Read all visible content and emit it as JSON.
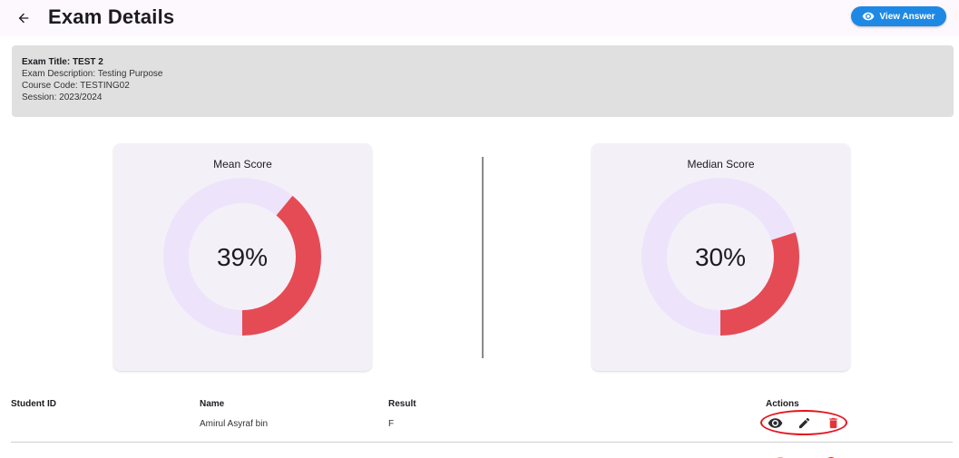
{
  "header": {
    "title": "Exam Details",
    "view_answer_label": "View Answer"
  },
  "exam_info": {
    "title_line": "Exam Title: TEST 2",
    "description_line": "Exam Description: Testing Purpose",
    "course_line": "Course Code:  TESTING02",
    "session_line": "Session: 2023/2024"
  },
  "scores": {
    "mean": {
      "label": "Mean Score",
      "value_text": "39%",
      "percent": 39
    },
    "median": {
      "label": "Median Score",
      "value_text": "30%",
      "percent": 30
    }
  },
  "colors": {
    "accent_blue": "#1e88e5",
    "donut_fill": "#e54b54",
    "donut_track": "#ede4fb",
    "delete_red": "#e5343a",
    "highlight_red": "#e5141e"
  },
  "table": {
    "headers": {
      "student_id": "Student ID",
      "name": "Name",
      "result": "Result",
      "actions": "Actions"
    },
    "rows": [
      {
        "student_id": "",
        "name": "Amirul Asyraf bin",
        "result": "F"
      }
    ]
  },
  "icons": {
    "back": "arrow-left-icon",
    "view_answer": "eye-icon",
    "row_view": "eye-icon",
    "row_edit": "pencil-icon",
    "row_delete": "trash-icon"
  }
}
